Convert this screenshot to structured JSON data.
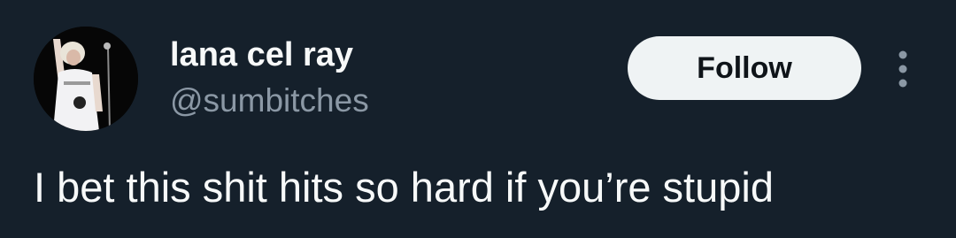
{
  "author": {
    "display_name": "lana cel ray",
    "handle": "@sumbitches",
    "avatar_icon": "avatar-photo"
  },
  "actions": {
    "follow_label": "Follow",
    "more_icon": "more-vertical-icon"
  },
  "tweet": {
    "text": "I bet this shit hits so hard if you’re stupid"
  },
  "colors": {
    "background": "#15202b",
    "primary_text": "#f7f9f9",
    "secondary_text": "#8b98a5",
    "button_bg": "#eff3f4",
    "button_text": "#0f1419"
  }
}
